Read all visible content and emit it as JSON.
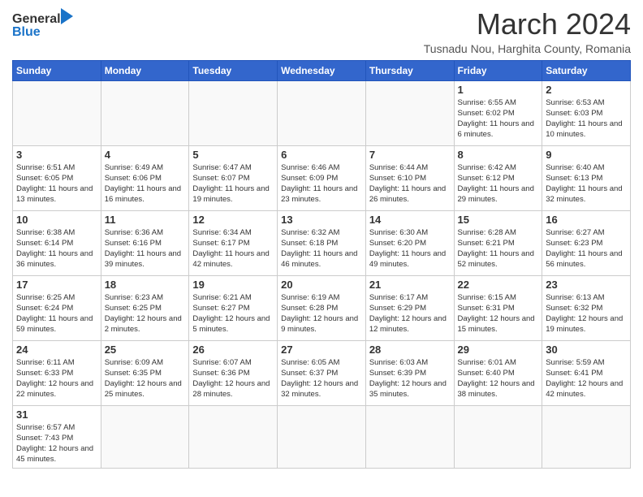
{
  "header": {
    "logo_general": "General",
    "logo_blue": "Blue",
    "month_title": "March 2024",
    "location": "Tusnadu Nou, Harghita County, Romania"
  },
  "days_of_week": [
    "Sunday",
    "Monday",
    "Tuesday",
    "Wednesday",
    "Thursday",
    "Friday",
    "Saturday"
  ],
  "weeks": [
    [
      {
        "day": "",
        "info": ""
      },
      {
        "day": "",
        "info": ""
      },
      {
        "day": "",
        "info": ""
      },
      {
        "day": "",
        "info": ""
      },
      {
        "day": "",
        "info": ""
      },
      {
        "day": "1",
        "info": "Sunrise: 6:55 AM\nSunset: 6:02 PM\nDaylight: 11 hours and 6 minutes."
      },
      {
        "day": "2",
        "info": "Sunrise: 6:53 AM\nSunset: 6:03 PM\nDaylight: 11 hours and 10 minutes."
      }
    ],
    [
      {
        "day": "3",
        "info": "Sunrise: 6:51 AM\nSunset: 6:05 PM\nDaylight: 11 hours and 13 minutes."
      },
      {
        "day": "4",
        "info": "Sunrise: 6:49 AM\nSunset: 6:06 PM\nDaylight: 11 hours and 16 minutes."
      },
      {
        "day": "5",
        "info": "Sunrise: 6:47 AM\nSunset: 6:07 PM\nDaylight: 11 hours and 19 minutes."
      },
      {
        "day": "6",
        "info": "Sunrise: 6:46 AM\nSunset: 6:09 PM\nDaylight: 11 hours and 23 minutes."
      },
      {
        "day": "7",
        "info": "Sunrise: 6:44 AM\nSunset: 6:10 PM\nDaylight: 11 hours and 26 minutes."
      },
      {
        "day": "8",
        "info": "Sunrise: 6:42 AM\nSunset: 6:12 PM\nDaylight: 11 hours and 29 minutes."
      },
      {
        "day": "9",
        "info": "Sunrise: 6:40 AM\nSunset: 6:13 PM\nDaylight: 11 hours and 32 minutes."
      }
    ],
    [
      {
        "day": "10",
        "info": "Sunrise: 6:38 AM\nSunset: 6:14 PM\nDaylight: 11 hours and 36 minutes."
      },
      {
        "day": "11",
        "info": "Sunrise: 6:36 AM\nSunset: 6:16 PM\nDaylight: 11 hours and 39 minutes."
      },
      {
        "day": "12",
        "info": "Sunrise: 6:34 AM\nSunset: 6:17 PM\nDaylight: 11 hours and 42 minutes."
      },
      {
        "day": "13",
        "info": "Sunrise: 6:32 AM\nSunset: 6:18 PM\nDaylight: 11 hours and 46 minutes."
      },
      {
        "day": "14",
        "info": "Sunrise: 6:30 AM\nSunset: 6:20 PM\nDaylight: 11 hours and 49 minutes."
      },
      {
        "day": "15",
        "info": "Sunrise: 6:28 AM\nSunset: 6:21 PM\nDaylight: 11 hours and 52 minutes."
      },
      {
        "day": "16",
        "info": "Sunrise: 6:27 AM\nSunset: 6:23 PM\nDaylight: 11 hours and 56 minutes."
      }
    ],
    [
      {
        "day": "17",
        "info": "Sunrise: 6:25 AM\nSunset: 6:24 PM\nDaylight: 11 hours and 59 minutes."
      },
      {
        "day": "18",
        "info": "Sunrise: 6:23 AM\nSunset: 6:25 PM\nDaylight: 12 hours and 2 minutes."
      },
      {
        "day": "19",
        "info": "Sunrise: 6:21 AM\nSunset: 6:27 PM\nDaylight: 12 hours and 5 minutes."
      },
      {
        "day": "20",
        "info": "Sunrise: 6:19 AM\nSunset: 6:28 PM\nDaylight: 12 hours and 9 minutes."
      },
      {
        "day": "21",
        "info": "Sunrise: 6:17 AM\nSunset: 6:29 PM\nDaylight: 12 hours and 12 minutes."
      },
      {
        "day": "22",
        "info": "Sunrise: 6:15 AM\nSunset: 6:31 PM\nDaylight: 12 hours and 15 minutes."
      },
      {
        "day": "23",
        "info": "Sunrise: 6:13 AM\nSunset: 6:32 PM\nDaylight: 12 hours and 19 minutes."
      }
    ],
    [
      {
        "day": "24",
        "info": "Sunrise: 6:11 AM\nSunset: 6:33 PM\nDaylight: 12 hours and 22 minutes."
      },
      {
        "day": "25",
        "info": "Sunrise: 6:09 AM\nSunset: 6:35 PM\nDaylight: 12 hours and 25 minutes."
      },
      {
        "day": "26",
        "info": "Sunrise: 6:07 AM\nSunset: 6:36 PM\nDaylight: 12 hours and 28 minutes."
      },
      {
        "day": "27",
        "info": "Sunrise: 6:05 AM\nSunset: 6:37 PM\nDaylight: 12 hours and 32 minutes."
      },
      {
        "day": "28",
        "info": "Sunrise: 6:03 AM\nSunset: 6:39 PM\nDaylight: 12 hours and 35 minutes."
      },
      {
        "day": "29",
        "info": "Sunrise: 6:01 AM\nSunset: 6:40 PM\nDaylight: 12 hours and 38 minutes."
      },
      {
        "day": "30",
        "info": "Sunrise: 5:59 AM\nSunset: 6:41 PM\nDaylight: 12 hours and 42 minutes."
      }
    ],
    [
      {
        "day": "31",
        "info": "Sunrise: 6:57 AM\nSunset: 7:43 PM\nDaylight: 12 hours and 45 minutes."
      },
      {
        "day": "",
        "info": ""
      },
      {
        "day": "",
        "info": ""
      },
      {
        "day": "",
        "info": ""
      },
      {
        "day": "",
        "info": ""
      },
      {
        "day": "",
        "info": ""
      },
      {
        "day": "",
        "info": ""
      }
    ]
  ]
}
